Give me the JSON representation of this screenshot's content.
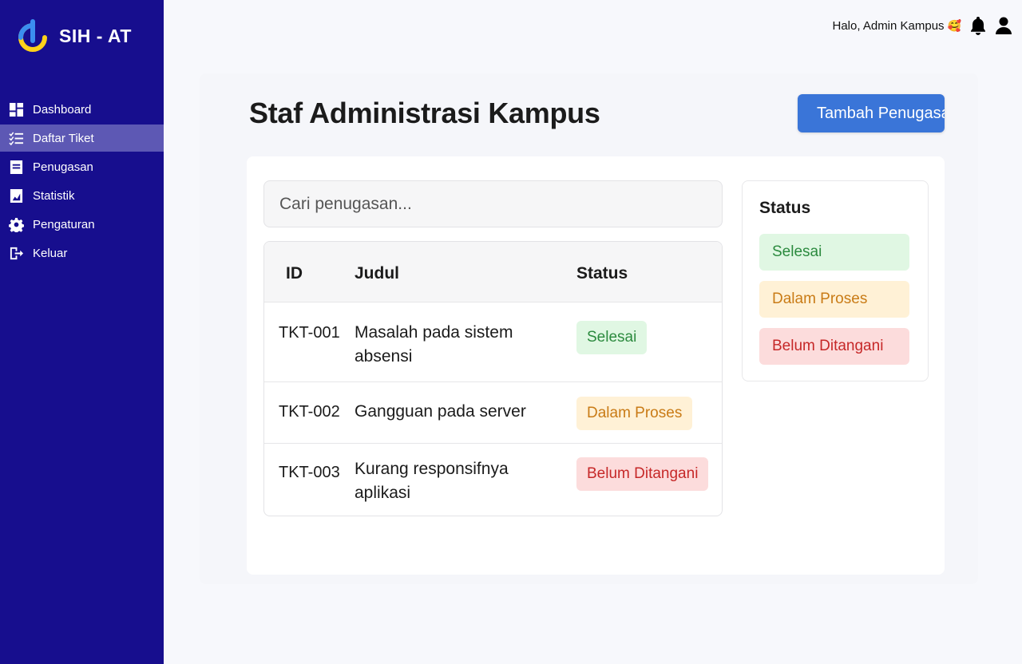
{
  "app": {
    "brand": "SIH - AT"
  },
  "sidebar": {
    "items": [
      {
        "label": "Dashboard",
        "icon": "dashboard-icon"
      },
      {
        "label": "Daftar Tiket",
        "icon": "checklist-icon",
        "active": true
      },
      {
        "label": "Penugasan",
        "icon": "clipboard-icon"
      },
      {
        "label": "Statistik",
        "icon": "chart-icon"
      },
      {
        "label": "Pengaturan",
        "icon": "gear-icon"
      },
      {
        "label": "Keluar",
        "icon": "logout-icon"
      }
    ]
  },
  "header": {
    "greeting": "Halo, Admin Kampus",
    "emoji": "🥰",
    "icons": [
      "bell-icon",
      "user-icon"
    ]
  },
  "main": {
    "title": "Staf Administrasi Kampus",
    "add_button": "Tambah Penugasan",
    "search_placeholder": "Cari penugasan...",
    "table": {
      "headers": [
        "ID",
        "Judul",
        "Status"
      ],
      "rows": [
        {
          "id": "TKT-001",
          "title": "Masalah pada sistem absensi",
          "status": "Selesai",
          "status_type": "done"
        },
        {
          "id": "TKT-002",
          "title": "Gangguan pada server",
          "status": "Dalam Proses",
          "status_type": "progress"
        },
        {
          "id": "TKT-003",
          "title": "Kurang responsifnya aplikasi",
          "status": "Belum Ditangani",
          "status_type": "open"
        }
      ]
    },
    "legend": {
      "title": "Status",
      "items": [
        "Selesai",
        "Dalam Proses",
        "Belum Ditangani"
      ]
    }
  },
  "colors": {
    "sidebar_bg": "#170e8e",
    "sidebar_active": "#5d58b4",
    "primary_button": "#3a75d8",
    "status_done_bg": "#e0f7e3",
    "status_done_text": "#2b8a3e",
    "status_progress_bg": "#fff1d6",
    "status_progress_text": "#c97b16",
    "status_open_bg": "#fcdcdc",
    "status_open_text": "#c62828"
  }
}
